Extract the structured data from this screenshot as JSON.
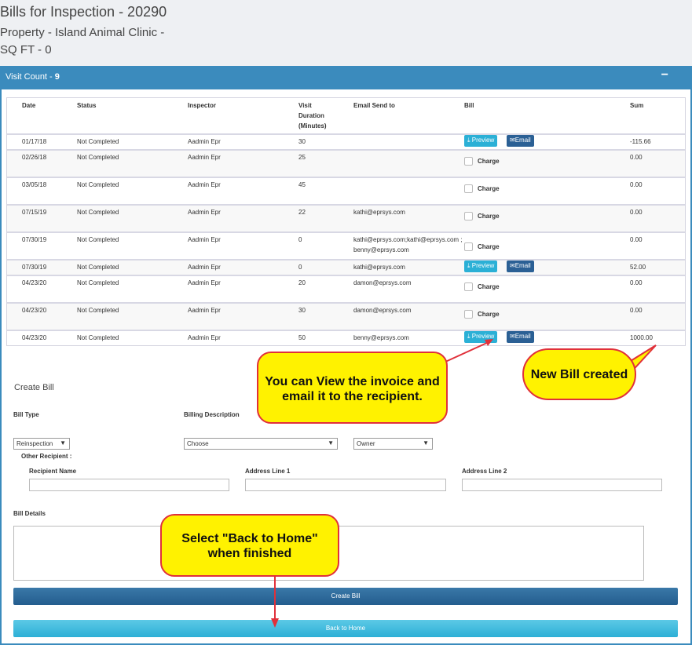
{
  "header": {
    "title": "Bills for Inspection - 20290",
    "property": "Property - Island Animal Clinic -",
    "sqft": "SQ FT - 0"
  },
  "panel": {
    "title_prefix": "Visit Count - ",
    "visit_count": "9",
    "collapse": "−"
  },
  "table": {
    "columns": [
      "Date",
      "Status",
      "Inspector",
      "Visit Duration (Minutes)",
      "Email Send to",
      "Bill",
      "Sum"
    ],
    "rows": [
      {
        "date": "01/17/18",
        "status": "Not Completed",
        "inspector": "Aadmin Epr",
        "duration": "30",
        "email": "",
        "bill": "buttons",
        "sum": "-115.66"
      },
      {
        "date": "02/26/18",
        "status": "Not Completed",
        "inspector": "Aadmin Epr",
        "duration": "25",
        "email": "",
        "bill": "charge",
        "sum": "0.00"
      },
      {
        "date": "03/05/18",
        "status": "Not Completed",
        "inspector": "Aadmin Epr",
        "duration": "45",
        "email": "",
        "bill": "charge",
        "sum": "0.00"
      },
      {
        "date": "07/15/19",
        "status": "Not Completed",
        "inspector": "Aadmin Epr",
        "duration": "22",
        "email": "kathi@eprsys.com",
        "bill": "charge",
        "sum": "0.00"
      },
      {
        "date": "07/30/19",
        "status": "Not Completed",
        "inspector": "Aadmin Epr",
        "duration": "0",
        "email": "kathi@eprsys.com;kathi@eprsys.com ; benny@eprsys.com",
        "bill": "charge",
        "sum": "0.00"
      },
      {
        "date": "07/30/19",
        "status": "Not Completed",
        "inspector": "Aadmin Epr",
        "duration": "0",
        "email": "kathi@eprsys.com",
        "bill": "buttons",
        "sum": "52.00"
      },
      {
        "date": "04/23/20",
        "status": "Not Completed",
        "inspector": "Aadmin Epr",
        "duration": "20",
        "email": "damon@eprsys.com",
        "bill": "charge",
        "sum": "0.00"
      },
      {
        "date": "04/23/20",
        "status": "Not Completed",
        "inspector": "Aadmin Epr",
        "duration": "30",
        "email": "damon@eprsys.com",
        "bill": "charge",
        "sum": "0.00"
      },
      {
        "date": "04/23/20",
        "status": "Not Completed",
        "inspector": "Aadmin Epr",
        "duration": "50",
        "email": "benny@eprsys.com",
        "bill": "buttons",
        "sum": "1000.00"
      }
    ],
    "preview_label": "Preview",
    "email_label": "Email",
    "charge_label": "Charge"
  },
  "form": {
    "title": "Create Bill",
    "bill_type_label": "Bill Type",
    "billing_desc_label": "Billing Description",
    "bill_type_value": "Reinspection",
    "billing_desc_value": "Choose",
    "recipient_type_value": "Owner",
    "other_recipient_label": "Other Recipient :",
    "recipient_name_label": "Recipient Name",
    "address1_label": "Address Line 1",
    "address2_label": "Address Line 2",
    "bill_details_label": "Bill Details",
    "create_button": "Create Bill",
    "back_button": "Back to Home"
  },
  "callouts": {
    "view": "You can View the invoice and email it to the recipient.",
    "new_bill": "New Bill created",
    "back": "Select \"Back to Home\" when finished"
  },
  "colors": {
    "panel_header": "#3b8bbd",
    "preview": "#2bb0d6",
    "email": "#2b6095",
    "callout_fill": "#fff200",
    "callout_border": "#e0303a"
  }
}
